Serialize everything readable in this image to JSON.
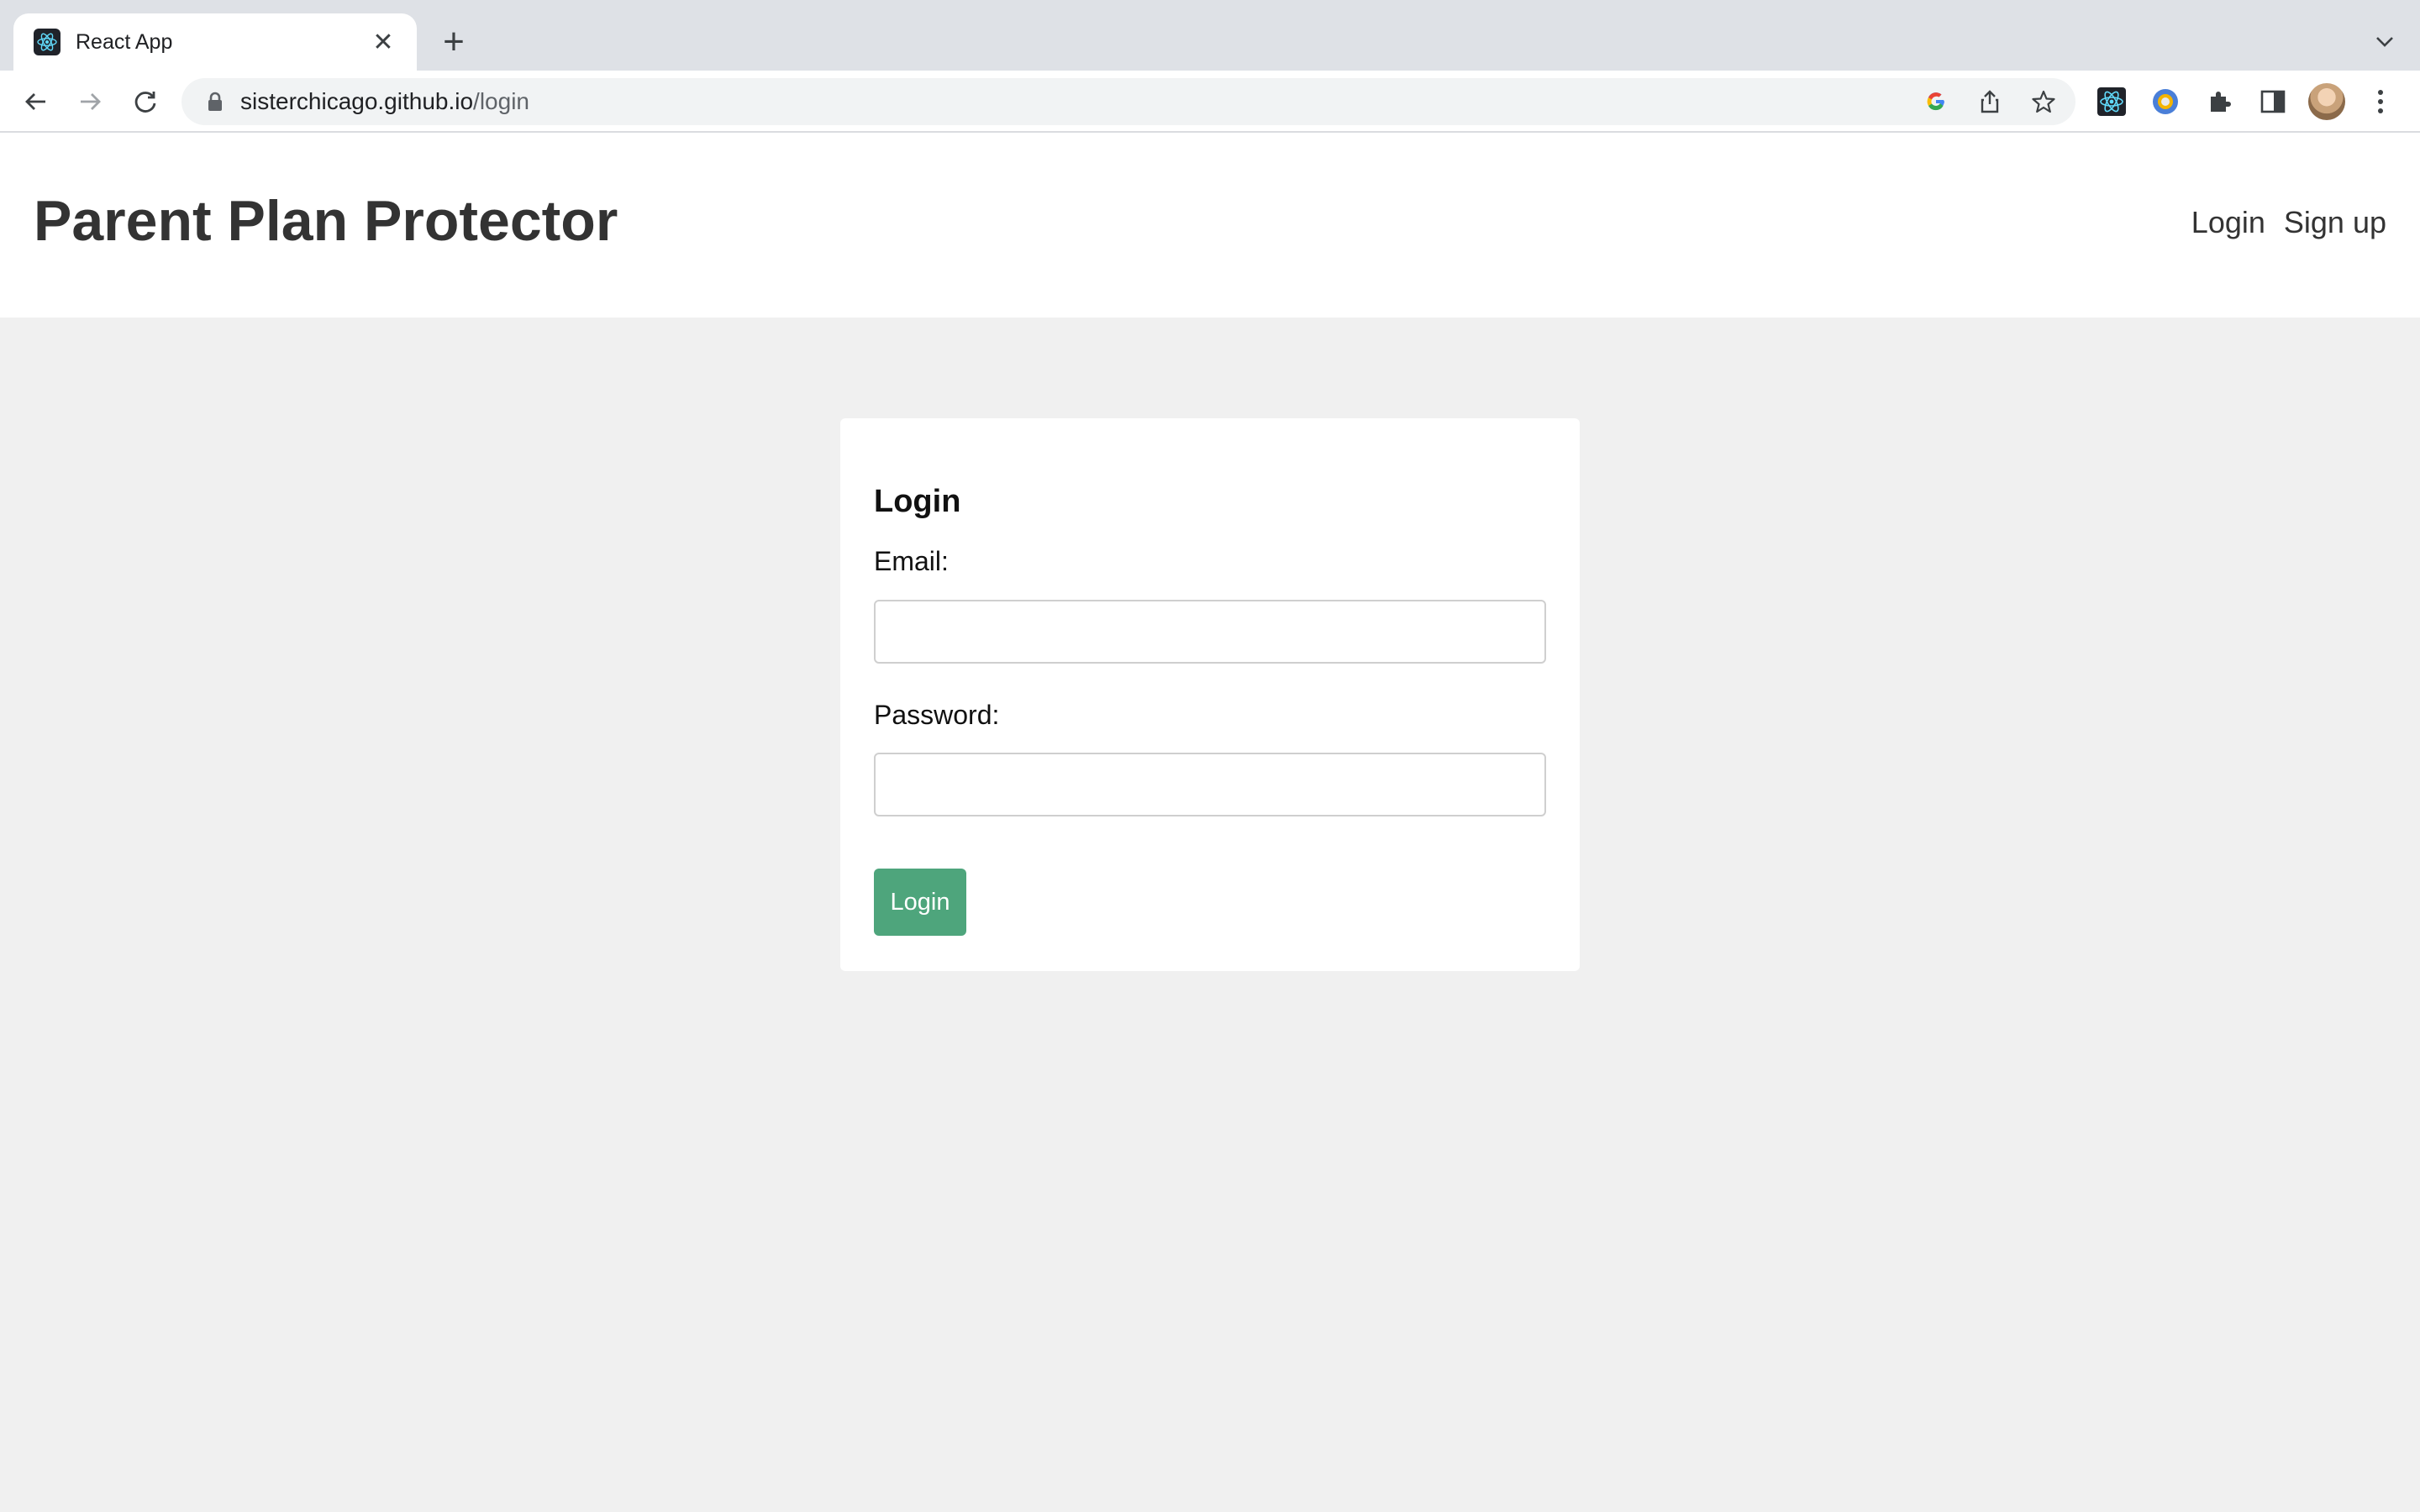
{
  "browser": {
    "tab": {
      "title": "React App",
      "close_glyph": "✕"
    },
    "new_tab_glyph": "+",
    "url": {
      "host": "sisterchicago.github.io",
      "path": "/login"
    },
    "icons": {
      "back": "arrow-left-icon",
      "forward": "arrow-right-icon",
      "reload": "reload-icon",
      "lock": "lock-icon",
      "google": "google-icon",
      "share": "share-icon",
      "bookmark": "star-icon",
      "extensions": [
        "react-devtools-icon",
        "color-picker-icon",
        "puzzle-icon",
        "side-panel-icon"
      ],
      "menu": "kebab-menu-icon"
    }
  },
  "site": {
    "title": "Parent Plan Protector",
    "nav": {
      "login": "Login",
      "signup": "Sign up"
    }
  },
  "login_form": {
    "heading": "Login",
    "email_label": "Email:",
    "email_value": "",
    "password_label": "Password:",
    "password_value": "",
    "submit_label": "Login"
  },
  "colors": {
    "button_green": "#4ea57c",
    "page_background": "#f0f0f0",
    "title_color": "#333333"
  }
}
